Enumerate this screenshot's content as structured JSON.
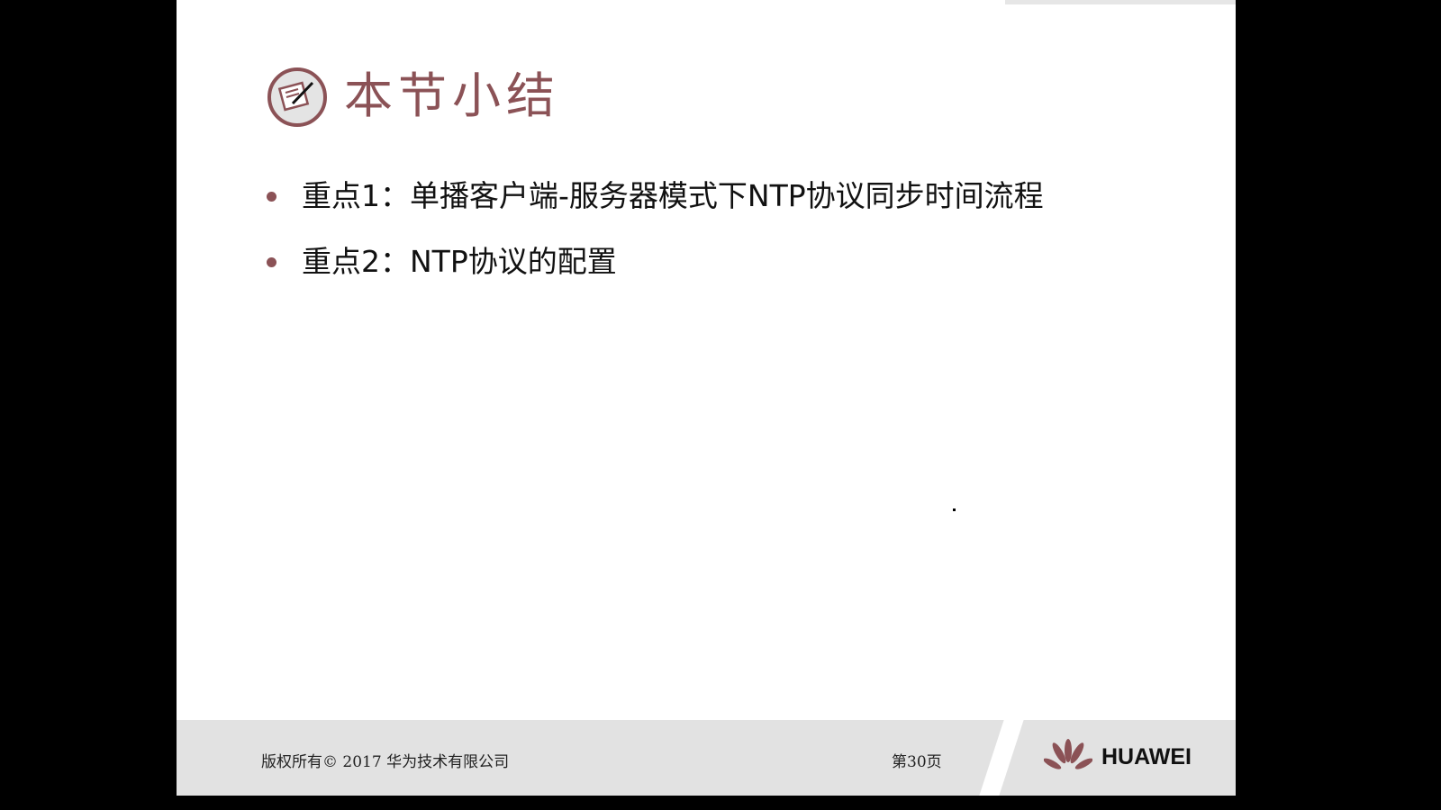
{
  "slide": {
    "title": "本节小结",
    "bullets": [
      {
        "label": "重点1：单播客户端-服务器模式下NTP协议同步时间流程"
      },
      {
        "label": "重点2：NTP协议的配置"
      }
    ],
    "footer": {
      "copyright": "版权所有© 2017 华为技术有限公司",
      "page": "第30页",
      "brand": "HUAWEI"
    }
  },
  "colors": {
    "accent": "#8b5256",
    "footer_bg": "#e2e2e2"
  }
}
